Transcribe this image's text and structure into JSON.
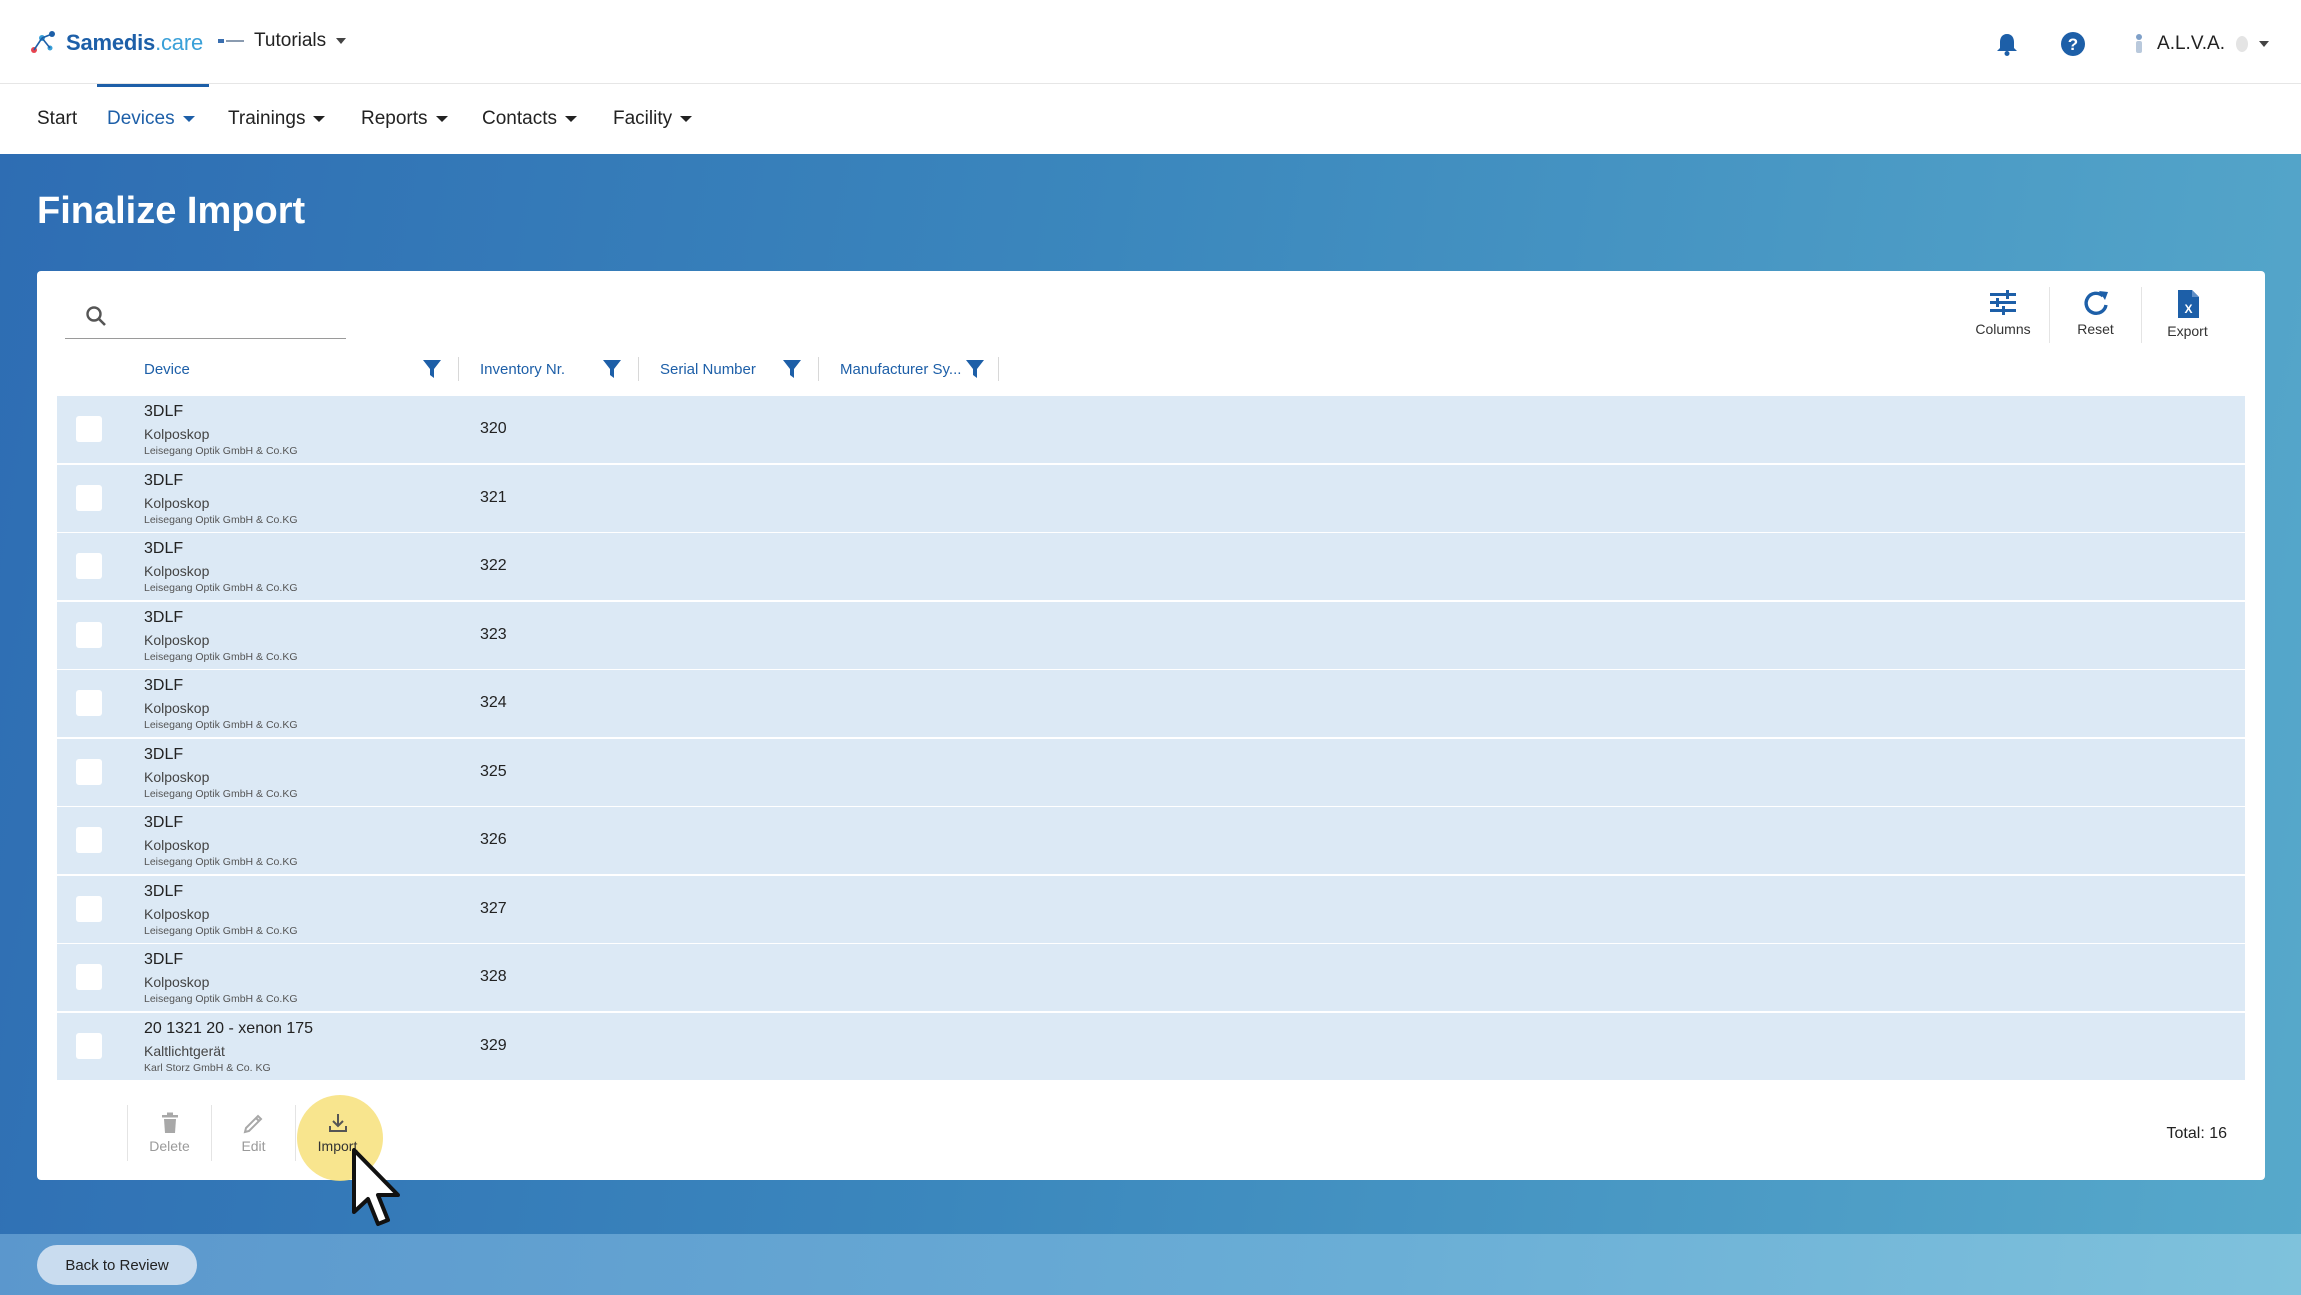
{
  "header": {
    "brand": "Samedis",
    "brand_suffix": ".care",
    "tenant": "Tutorials",
    "user": "A.L.V.A."
  },
  "nav": {
    "items": [
      {
        "label": "Start"
      },
      {
        "label": "Devices"
      },
      {
        "label": "Trainings"
      },
      {
        "label": "Reports"
      },
      {
        "label": "Contacts"
      },
      {
        "label": "Facility"
      }
    ]
  },
  "page": {
    "title": "Finalize Import"
  },
  "search": {
    "value": "",
    "placeholder": ""
  },
  "toolbar": {
    "columns": "Columns",
    "reset": "Reset",
    "export": "Export"
  },
  "table": {
    "columns": [
      "Device",
      "Inventory Nr.",
      "Serial Number",
      "Manufacturer Sy..."
    ],
    "rows": [
      {
        "name": "3DLF",
        "type": "Kolposkop",
        "manufacturer": "Leisegang Optik GmbH & Co.KG",
        "inventory": "320"
      },
      {
        "name": "3DLF",
        "type": "Kolposkop",
        "manufacturer": "Leisegang Optik GmbH & Co.KG",
        "inventory": "321"
      },
      {
        "name": "3DLF",
        "type": "Kolposkop",
        "manufacturer": "Leisegang Optik GmbH & Co.KG",
        "inventory": "322"
      },
      {
        "name": "3DLF",
        "type": "Kolposkop",
        "manufacturer": "Leisegang Optik GmbH & Co.KG",
        "inventory": "323"
      },
      {
        "name": "3DLF",
        "type": "Kolposkop",
        "manufacturer": "Leisegang Optik GmbH & Co.KG",
        "inventory": "324"
      },
      {
        "name": "3DLF",
        "type": "Kolposkop",
        "manufacturer": "Leisegang Optik GmbH & Co.KG",
        "inventory": "325"
      },
      {
        "name": "3DLF",
        "type": "Kolposkop",
        "manufacturer": "Leisegang Optik GmbH & Co.KG",
        "inventory": "326"
      },
      {
        "name": "3DLF",
        "type": "Kolposkop",
        "manufacturer": "Leisegang Optik GmbH & Co.KG",
        "inventory": "327"
      },
      {
        "name": "3DLF",
        "type": "Kolposkop",
        "manufacturer": "Leisegang Optik GmbH & Co.KG",
        "inventory": "328"
      },
      {
        "name": "20 1321 20 - xenon 175",
        "type": "Kaltlichtgerät",
        "manufacturer": "Karl Storz GmbH & Co. KG",
        "inventory": "329"
      }
    ]
  },
  "actions": {
    "delete": "Delete",
    "edit": "Edit",
    "import": "Import"
  },
  "total": "Total: 16",
  "footer": {
    "back": "Back to Review"
  },
  "colors": {
    "primary": "#1d5fa8",
    "row_bg": "#dce9f5",
    "highlight": "#f7e07a"
  }
}
